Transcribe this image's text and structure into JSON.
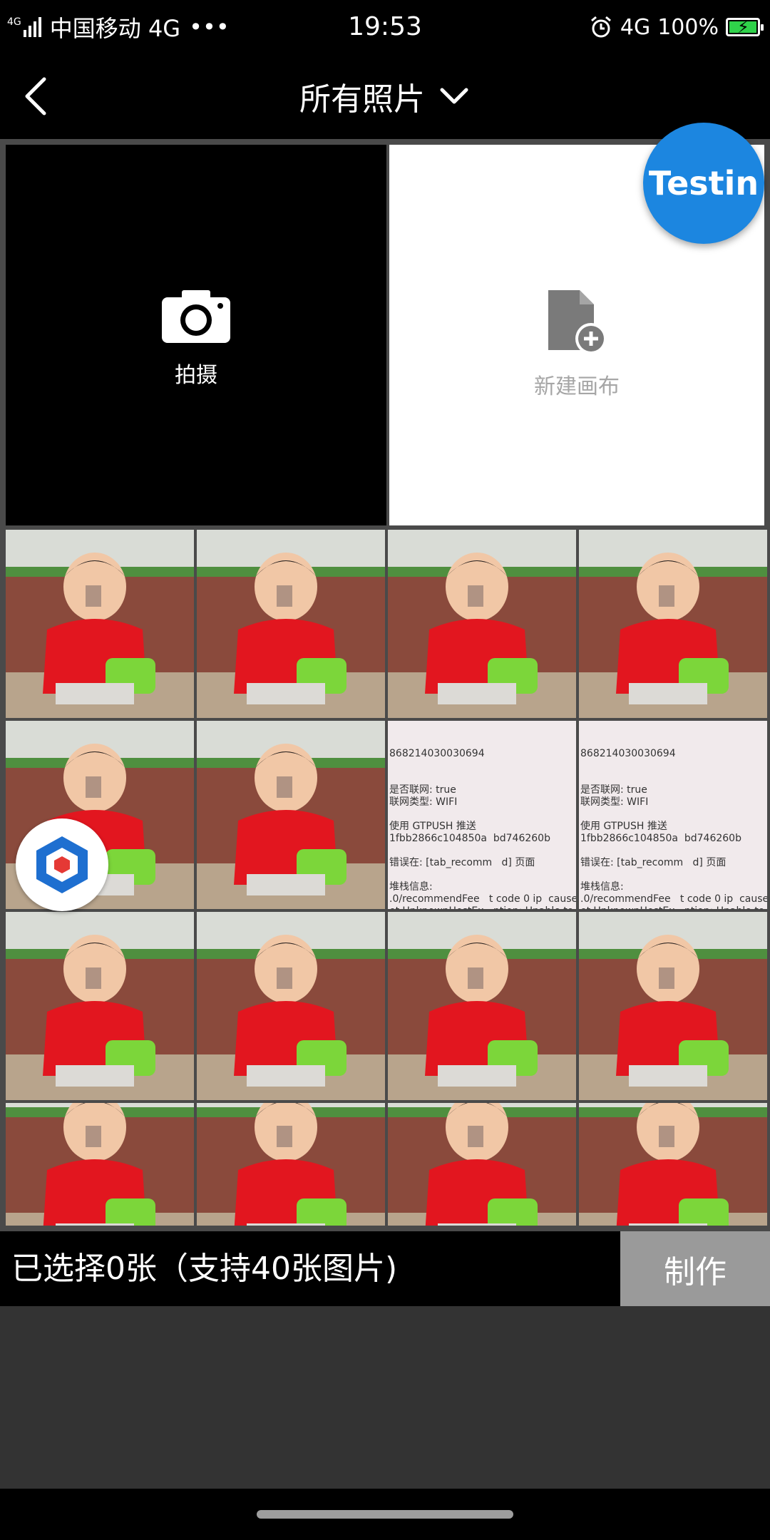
{
  "status_bar": {
    "network_small": "4G",
    "carrier": "中国移动 4G",
    "more": "•••",
    "time": "19:53",
    "network": "4G",
    "battery": "100%",
    "icons": [
      "signal-icon",
      "alarm-icon",
      "battery-charging-icon"
    ]
  },
  "nav": {
    "back_icon": "chevron-left-icon",
    "title": "所有照片",
    "dropdown_icon": "chevron-down-icon"
  },
  "tiles": {
    "camera_label": "拍摄",
    "canvas_label": "新建画布"
  },
  "overlays": {
    "testin_label": "Testin"
  },
  "screenshot_text": [
    "868214030030694",
    "是否联网: true\n联网类型: WIFI\n\n使用 GTPUSH 推送\n1fbb2866c104850a  bd746260b\n\n错误在: [tab_recomm   d] 页面\n\n堆栈信息:\n.0/recommendFee   t code 0 ip  cause\net.UnknownHostEx   ption: Unable to reso\n'app.jike.ruguoapp.c   ': No address\nciated with hostnam"
  ],
  "bottom": {
    "selection_text": "已选择0张（支持40张图片)",
    "make_button": "制作"
  },
  "colors": {
    "accent_blue": "#1c86e0",
    "battery_green": "#2fd24a",
    "button_gray": "#9a9a9a"
  }
}
